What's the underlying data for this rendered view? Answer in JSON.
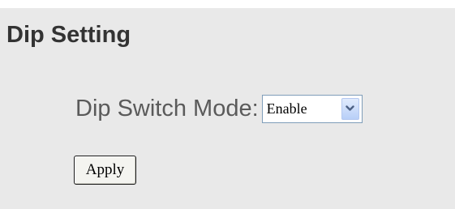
{
  "page": {
    "title": "Dip Setting"
  },
  "form": {
    "dip_switch_mode": {
      "label": "Dip Switch Mode:",
      "selected": "Enable",
      "arrow_icon": "chevron-down-icon"
    },
    "apply_label": "Apply"
  },
  "colors": {
    "panel_background": "#e9e9e9",
    "title_text": "#333333",
    "label_text": "#5a5a5a",
    "select_border": "#7f9db9",
    "dropdown_arrow": "#4d6185"
  }
}
